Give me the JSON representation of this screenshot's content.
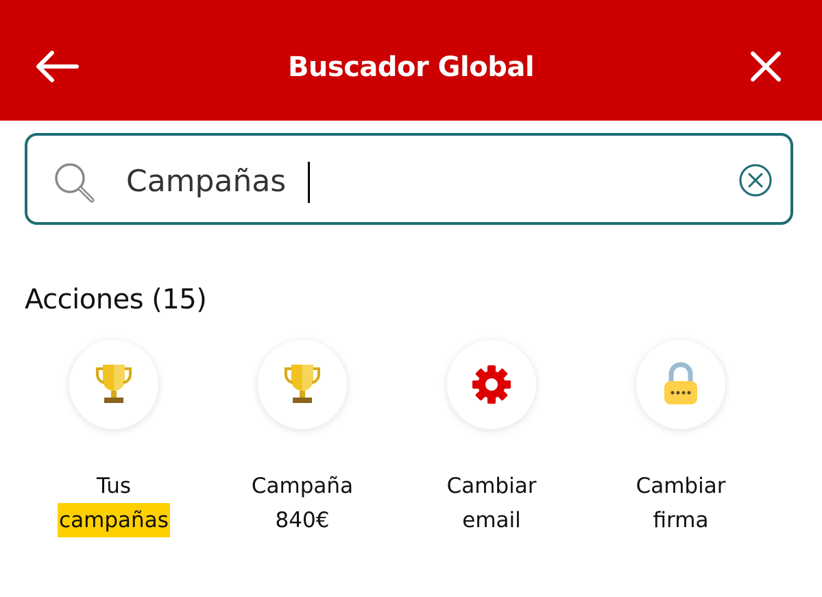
{
  "header": {
    "title": "Buscador Global",
    "back_icon": "arrow-left-icon",
    "close_icon": "close-icon",
    "background_color": "#cc0000"
  },
  "search": {
    "value": "Campañas",
    "search_icon": "search-icon",
    "clear_icon": "clear-circle-icon",
    "border_color": "#1e6d72"
  },
  "section": {
    "title": "Acciones (15)"
  },
  "actions": [
    {
      "line1": "Tus",
      "line2": "campañas",
      "icon": "trophy-icon",
      "highlight": "campañas"
    },
    {
      "line1": "Campaña",
      "line2": "840€",
      "icon": "trophy-icon"
    },
    {
      "line1": "Cambiar",
      "line2": "email",
      "icon": "gear-icon"
    },
    {
      "line1": "Cambiar",
      "line2": "firma",
      "icon": "padlock-icon"
    }
  ],
  "colors": {
    "highlight": "#ffd000",
    "trophy": "#f2c320",
    "gear": "#dd0000",
    "lock_body": "#ffd04a",
    "lock_shackle": "#9bbbd1"
  }
}
